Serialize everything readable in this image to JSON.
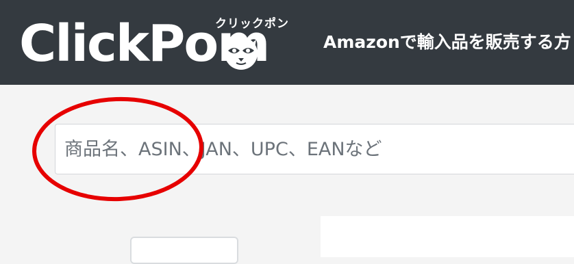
{
  "header": {
    "logo_text": "ClickPom",
    "logo_kana": "クリックポン",
    "tagline": "Amazonで輸入品を販売する方"
  },
  "search": {
    "placeholder": "商品名、ASIN、JAN、UPC、EANなど"
  },
  "colors": {
    "header_bg": "#343a40",
    "page_bg": "#f4f4f4",
    "annotation": "#e60000"
  }
}
